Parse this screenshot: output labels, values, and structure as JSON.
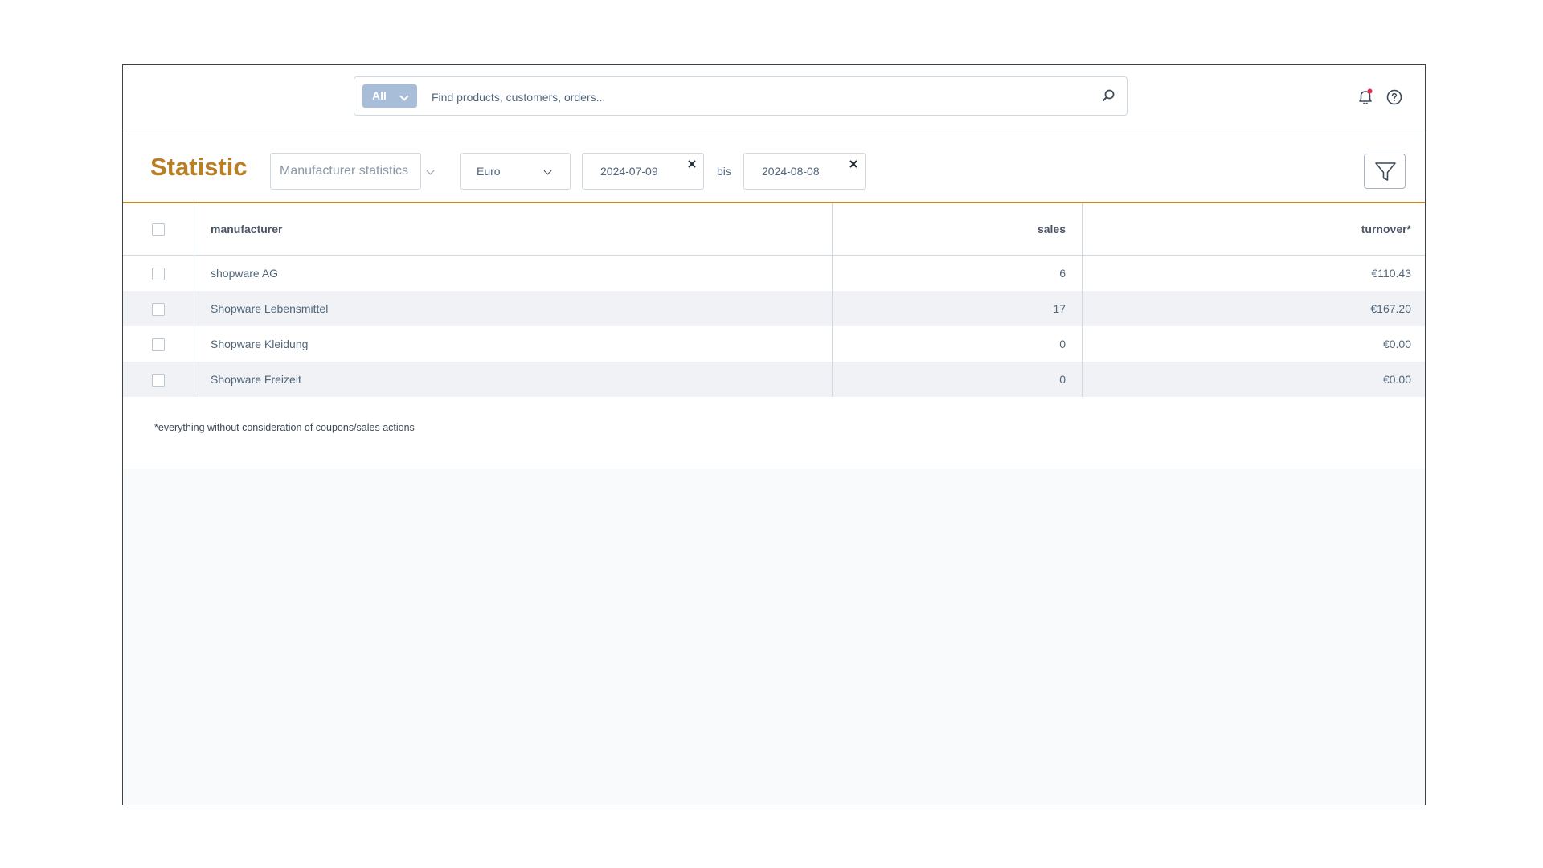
{
  "search": {
    "type_label": "All",
    "placeholder": "Find products, customers, orders..."
  },
  "header": {
    "title": "Statistic",
    "statistic_type": "Manufacturer statistics",
    "currency": "Euro",
    "date_from": "2024-07-09",
    "date_separator": "bis",
    "date_to": "2024-08-08"
  },
  "table": {
    "columns": [
      "manufacturer",
      "sales",
      "turnover*"
    ],
    "rows": [
      {
        "manufacturer": "shopware AG",
        "sales": "6",
        "turnover": "€110.43"
      },
      {
        "manufacturer": "Shopware Lebensmittel",
        "sales": "17",
        "turnover": "€167.20"
      },
      {
        "manufacturer": "Shopware Kleidung",
        "sales": "0",
        "turnover": "€0.00"
      },
      {
        "manufacturer": "Shopware Freizeit",
        "sales": "0",
        "turnover": "€0.00"
      }
    ]
  },
  "footnote": "*everything without consideration of coupons/sales actions",
  "colors": {
    "accent": "#b97f27",
    "notification_dot": "#de294c",
    "search_type_bg": "#a8bdd8"
  },
  "icons": {
    "search": "search-icon",
    "notifications": "bell-icon",
    "help": "help-icon",
    "filter": "filter-icon",
    "clear": "close-icon"
  }
}
